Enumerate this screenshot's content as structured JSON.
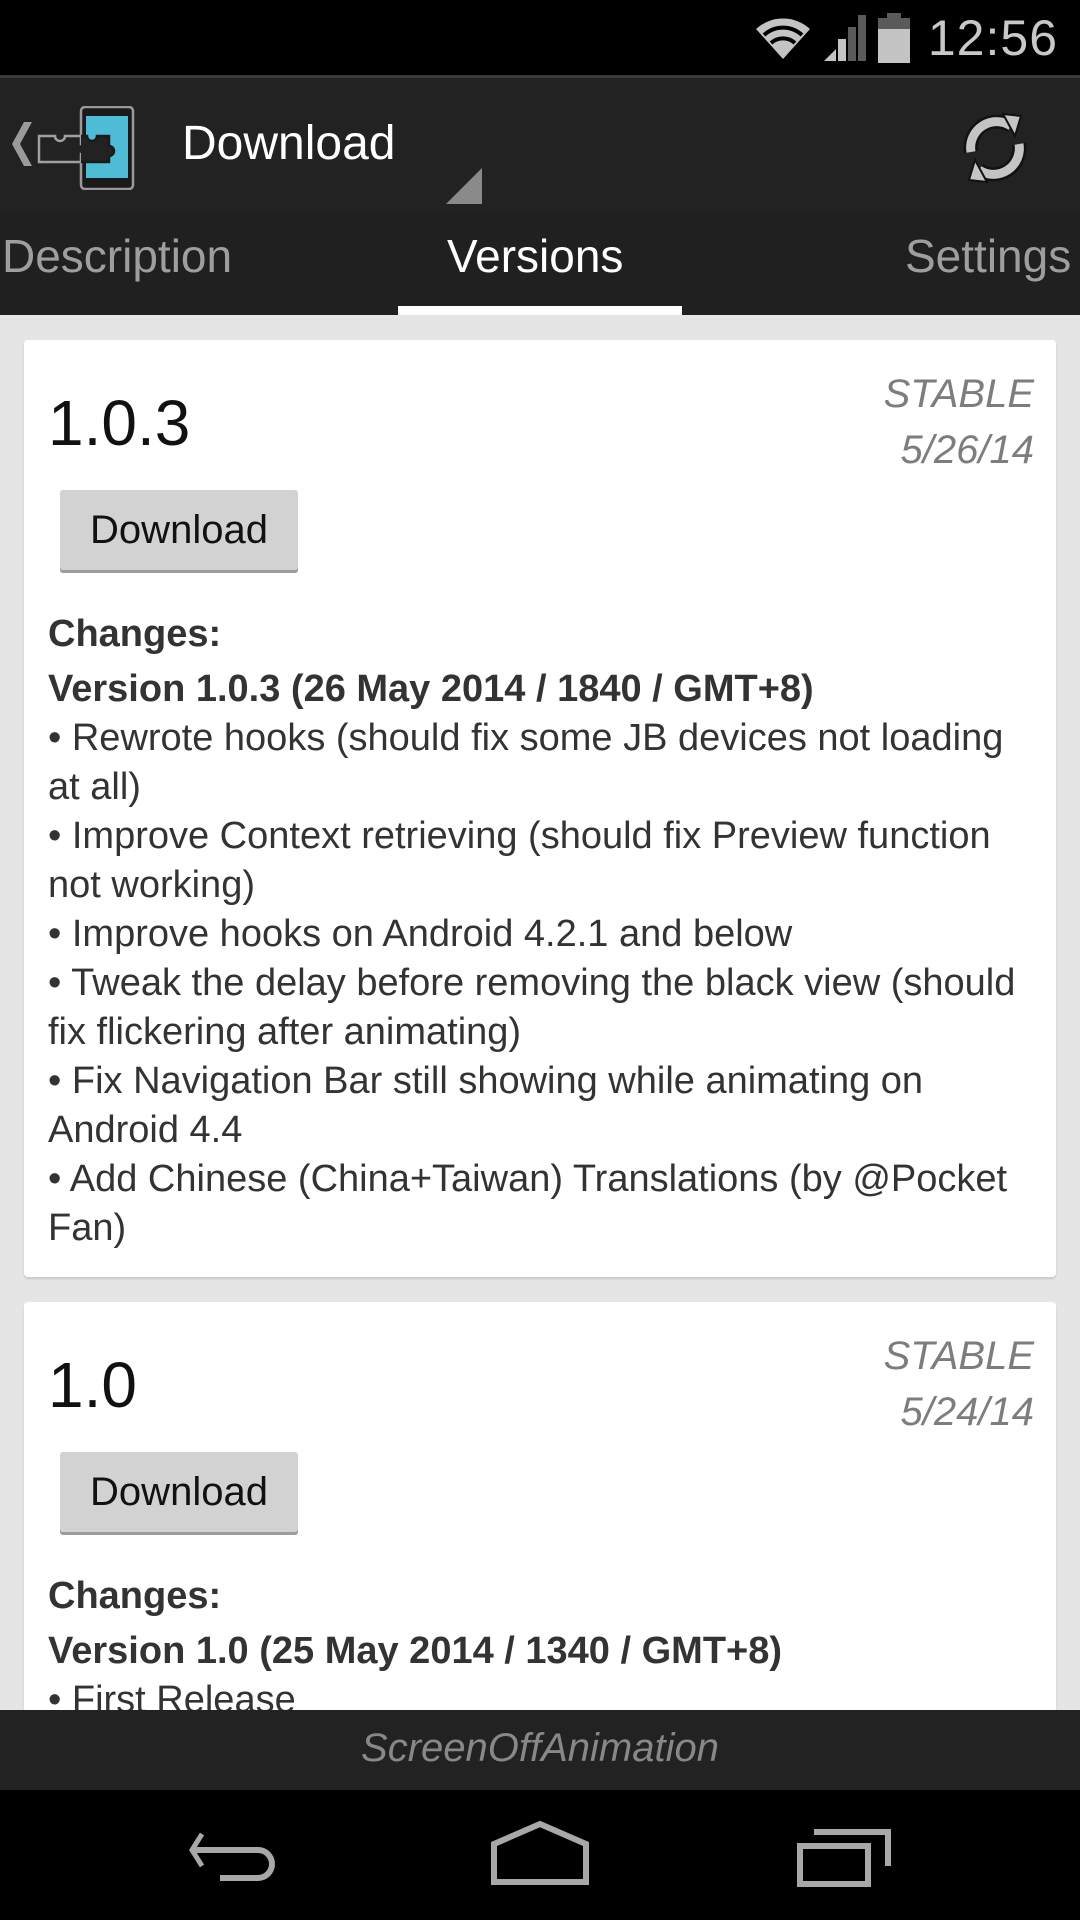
{
  "status_bar": {
    "time": "12:56",
    "icons": [
      "wifi-icon",
      "cell-signal-icon",
      "battery-icon"
    ]
  },
  "action_bar": {
    "title": "Download",
    "icons": [
      "up-navigation-icon",
      "xposed-app-icon",
      "spinner-dropdown-icon",
      "refresh-icon"
    ]
  },
  "tabs": [
    {
      "label": "Description",
      "active": false
    },
    {
      "label": "Versions",
      "active": true
    },
    {
      "label": "Settings",
      "active": false
    }
  ],
  "versions": [
    {
      "name": "1.0.3",
      "channel": "STABLE",
      "date": "5/26/14",
      "download_label": "Download",
      "changes_header": "Changes:",
      "changes_title": "Version 1.0.3 (26 May 2014 / 1840 / GMT+8)",
      "changes": [
        "• Rewrote hooks (should fix some JB devices not loading at all)",
        "• Improve Context retrieving (should fix Preview function not working)",
        "• Improve hooks on Android 4.2.1 and below",
        "• Tweak the delay before removing the black view (should fix flickering after animating)",
        "• Fix Navigation Bar still showing while animating on Android 4.4",
        "• Add Chinese (China+Taiwan) Translations (by @Pocket Fan)"
      ]
    },
    {
      "name": "1.0",
      "channel": "STABLE",
      "date": "5/24/14",
      "download_label": "Download",
      "changes_header": "Changes:",
      "changes_title": "Version 1.0 (25 May 2014 / 1340 / GMT+8)",
      "changes": [
        "• First Release"
      ]
    }
  ],
  "footer": {
    "module_name": "ScreenOffAnimation"
  },
  "nav_bar": {
    "buttons": [
      "back",
      "home",
      "recents"
    ]
  }
}
